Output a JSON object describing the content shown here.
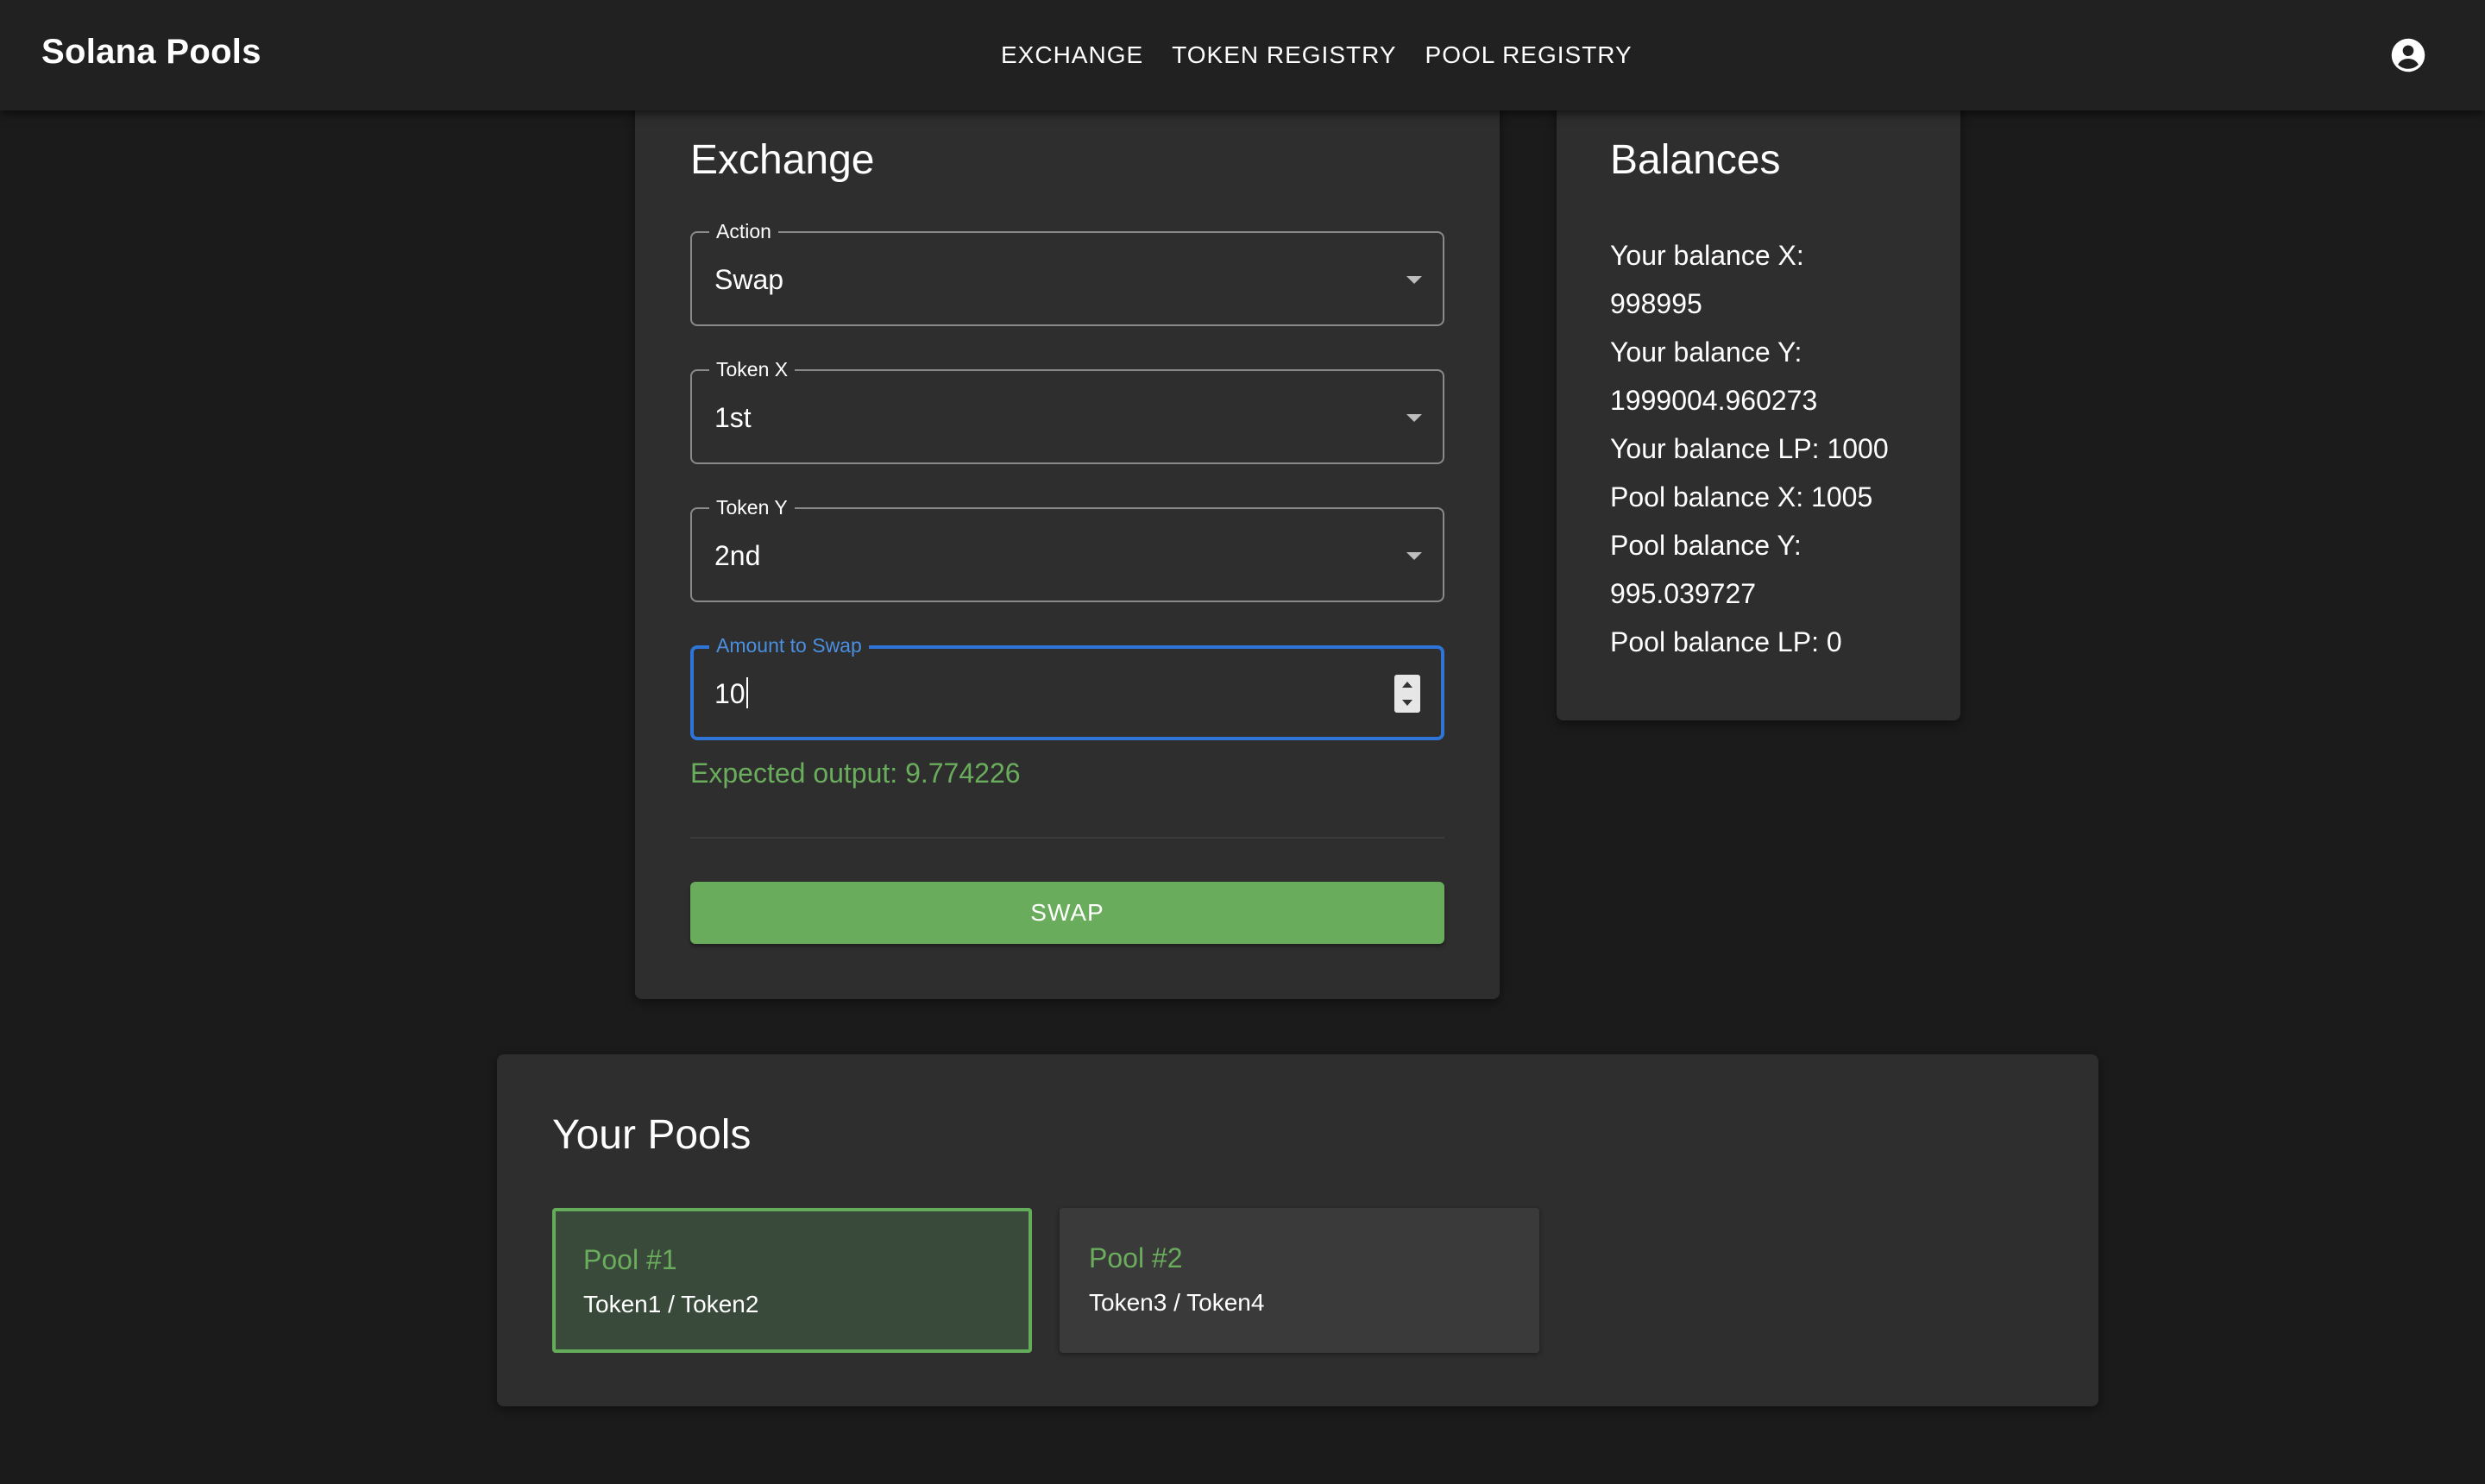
{
  "app": {
    "title": "Solana Pools"
  },
  "nav": {
    "items": [
      "EXCHANGE",
      "TOKEN REGISTRY",
      "POOL REGISTRY"
    ]
  },
  "exchange": {
    "title": "Exchange",
    "action": {
      "label": "Action",
      "value": "Swap"
    },
    "token_x": {
      "label": "Token X",
      "value": "1st"
    },
    "token_y": {
      "label": "Token Y",
      "value": "2nd"
    },
    "amount": {
      "label": "Amount to Swap",
      "value": "10"
    },
    "expected_output": "Expected output: 9.774226",
    "swap_label": "SWAP"
  },
  "balances": {
    "title": "Balances",
    "lines": [
      "Your balance X:",
      "998995",
      "Your balance Y:",
      "1999004.960273",
      "Your balance LP: 1000",
      "Pool balance X: 1005",
      "Pool balance Y:",
      "995.039727",
      "Pool balance LP: 0"
    ]
  },
  "pools": {
    "title": "Your Pools",
    "items": [
      {
        "name": "Pool #1",
        "pair": "Token1 / Token2",
        "selected": true
      },
      {
        "name": "Pool #2",
        "pair": "Token3 / Token4",
        "selected": false
      }
    ]
  },
  "colors": {
    "background": "#1b1b1b",
    "appbar": "#212121",
    "card": "#2e2e2e",
    "accent_green": "#68ac5c",
    "focus_blue": "#2f75d8"
  },
  "icons": {
    "account": "account-circle-icon",
    "select": "caret-down-icon"
  }
}
